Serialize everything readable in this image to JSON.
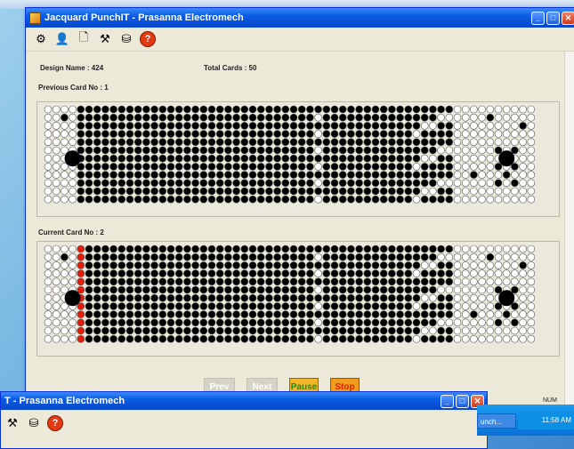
{
  "window": {
    "title": "Jacquard PunchIT - Prasanna Electromech",
    "controls": [
      "minimize-icon",
      "maximize-icon",
      "close-icon"
    ]
  },
  "toolbar": {
    "icons": [
      "settings-icon",
      "user-icon",
      "document-icon",
      "tools-icon",
      "database-icon",
      "help-icon"
    ]
  },
  "design": {
    "name_label": "Design Name : 424",
    "total_cards_label": "Total Cards : 50"
  },
  "previous_card": {
    "label": "Previous Card No : 1"
  },
  "current_card": {
    "label": "Current Card No : 2"
  },
  "buttons": {
    "prev": "Prev",
    "next": "Next",
    "pause": "Pause",
    "stop": "Stop"
  },
  "taskbar": {
    "num": "NUM",
    "task_label": "unch...",
    "clock": "11:58 AM"
  },
  "background_window": {
    "title": "T - Prasanna Electromech"
  },
  "colors": {
    "punched": "#000000",
    "unpunched": "#ffffff",
    "highlight": "#e31c0c",
    "prev_next_disabled": "#d7d3c6",
    "pause": "#f2b628",
    "stop": "#f29c1c"
  }
}
